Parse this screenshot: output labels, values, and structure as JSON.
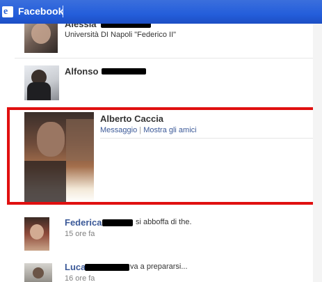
{
  "window": {
    "title": "Facebook"
  },
  "colors": {
    "titlebar": "#245edb",
    "link": "#3b5998",
    "highlight": "#e01010"
  },
  "list": [
    {
      "name": "Alessia",
      "detail": "Università DI Napoli \"Federico II\""
    },
    {
      "name": "Alfonso"
    },
    {
      "name": "Alberto Caccia",
      "action_message": "Messaggio",
      "separator": "|",
      "action_friends": "Mostra gli amici"
    },
    {
      "name": "Federica",
      "status": "si abboffa di the.",
      "time": "15 ore fa"
    },
    {
      "name": "Luca",
      "status": "va a prepararsi...",
      "time": "16 ore fa"
    }
  ]
}
